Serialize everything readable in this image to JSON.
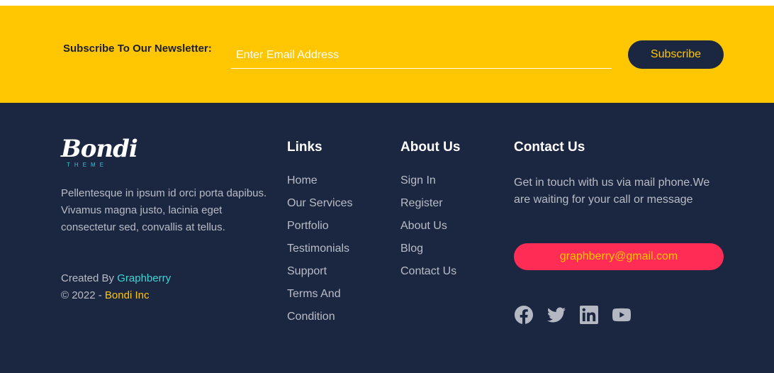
{
  "newsletter": {
    "label": "Subscribe To Our Newsletter:",
    "email_placeholder": "Enter Email Address",
    "email_value": "",
    "button_label": "Subscribe"
  },
  "brand": {
    "logo_text": "Bondi",
    "logo_subtext": "THEME",
    "description": "Pellentesque in ipsum id orci porta dapibus. Vivamus magna justo, lacinia eget consectetur sed, convallis at tellus.",
    "created_by_prefix": "Created By ",
    "created_by_link": "Graphberry",
    "copyright_prefix": "© 2022 - ",
    "copyright_link": "Bondi Inc"
  },
  "links": {
    "heading": "Links",
    "items": [
      "Home",
      "Our Services",
      "Portfolio",
      "Testimonials",
      "Support",
      "Terms And",
      "Condition"
    ]
  },
  "about": {
    "heading": "About Us",
    "items": [
      "Sign In",
      "Register",
      "About Us",
      "Blog",
      "Contact Us"
    ]
  },
  "contact": {
    "heading": "Contact Us",
    "text": "Get in touch with us via mail phone.We are waiting for your call or message",
    "email": "graphberry@gmail.com",
    "socials": [
      "facebook-icon",
      "twitter-icon",
      "linkedin-icon",
      "youtube-icon"
    ]
  },
  "colors": {
    "newsletter_bg": "#ffc601",
    "footer_bg": "#1b2740",
    "email_pill": "#ff2d55",
    "accent_teal": "#3fd3d6",
    "accent_gold": "#ffc601"
  }
}
